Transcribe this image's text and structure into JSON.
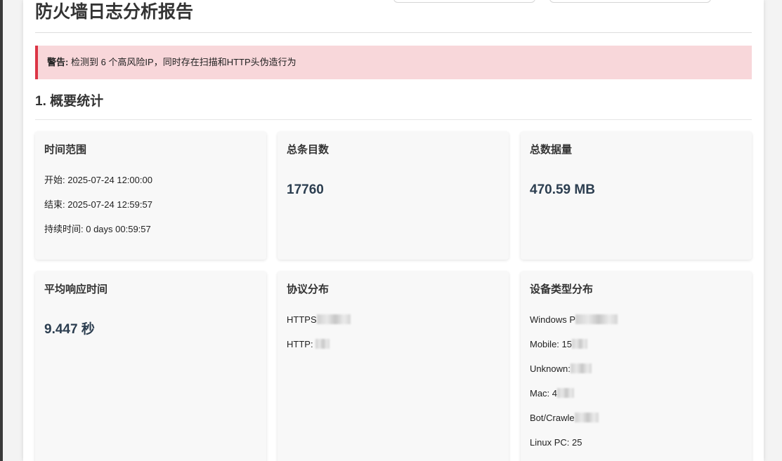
{
  "report": {
    "title": "防火墙日志分析报告"
  },
  "alert": {
    "label": "警告:",
    "message": " 检测到 6 个高风险IP，同时存在扫描和HTTP头伪造行为"
  },
  "section": {
    "title": "1. 概要统计"
  },
  "cards": {
    "time_range": {
      "title": "时间范围",
      "start": "开始: 2025-07-24 12:00:00",
      "end": "结束: 2025-07-24 12:59:57",
      "duration": "持续时间: 0 days 00:59:57"
    },
    "total_entries": {
      "title": "总条目数",
      "value": "17760"
    },
    "total_data": {
      "title": "总数据量",
      "value": "470.59 MB"
    },
    "avg_response": {
      "title": "平均响应时间",
      "value": "9.447 秒"
    },
    "protocol": {
      "title": "协议分布",
      "https": "HTTPS",
      "http": "HTTP: "
    },
    "device": {
      "title": "设备类型分布",
      "windows": "Windows P",
      "mobile": "Mobile: 15",
      "unknown": "Unknown:",
      "mac": "Mac: 4",
      "bot": "Bot/Crawle",
      "linux": "Linux PC: 25"
    }
  }
}
